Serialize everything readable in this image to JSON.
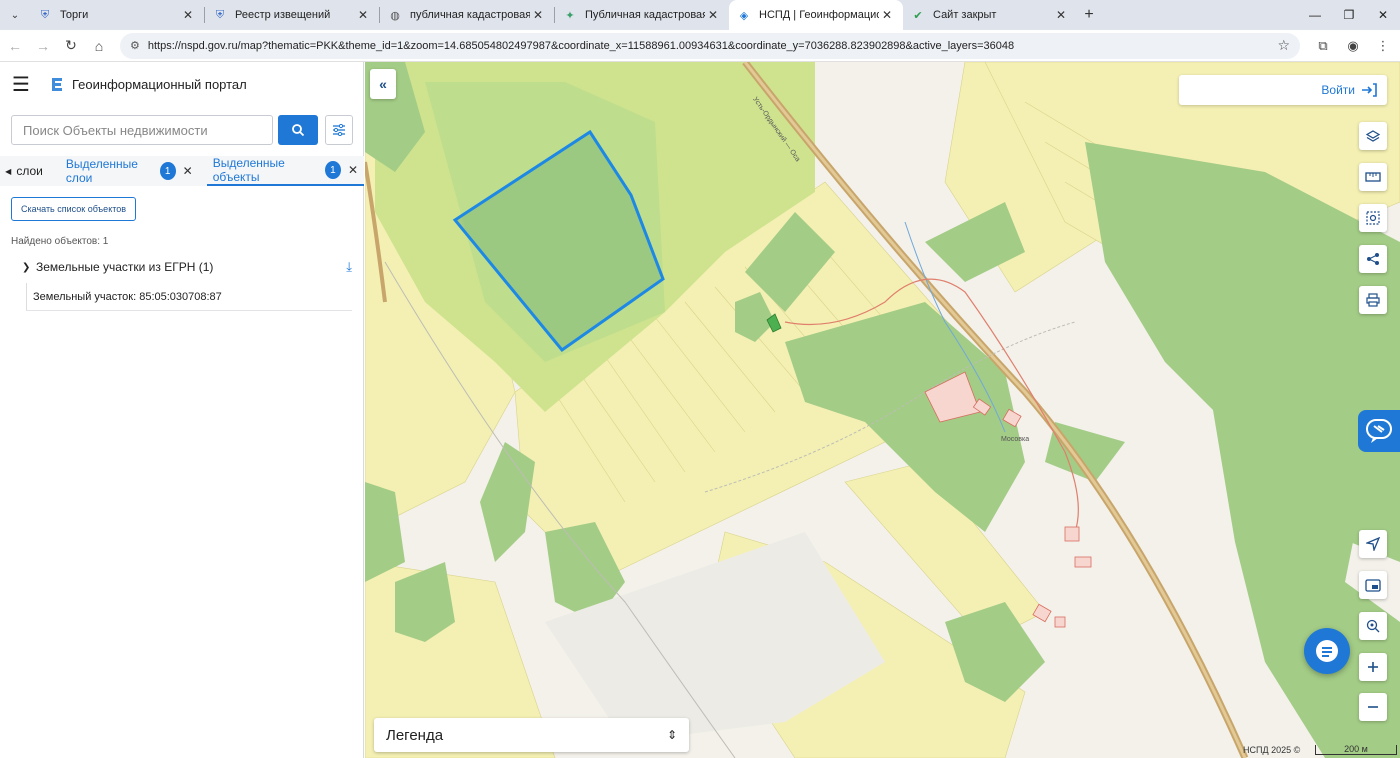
{
  "browser": {
    "tabs": [
      {
        "label": "Торги",
        "icon": "shield-icon"
      },
      {
        "label": "Реестр извещений",
        "icon": "shield-icon"
      },
      {
        "label": "публичная кадастровая карта",
        "icon": "globe-icon"
      },
      {
        "label": "Публичная кадастровая карта",
        "icon": "map-icon"
      },
      {
        "label": "НСПД | Геоинформационный",
        "icon": "nspd-icon",
        "active": true
      },
      {
        "label": "Сайт закрыт",
        "icon": "check-circle-icon"
      }
    ],
    "url": "https://nspd.gov.ru/map?thematic=PKK&theme_id=1&zoom=14.685054802497987&coordinate_x=11588961.00934631&coordinate_y=7036288.823902898&active_layers=36048"
  },
  "panel": {
    "title": "Геоинформационный портал",
    "search_placeholder": "Поиск Объекты недвижимости",
    "tabs": {
      "layers_label": "слои",
      "selected_layers_label": "Выделенные слои",
      "selected_layers_count": "1",
      "selected_objects_label": "Выделенные объекты",
      "selected_objects_count": "1"
    },
    "download_button": "Скачать список объектов",
    "found_text": "Найдено объектов: 1",
    "group_label": "Земельные участки из ЕГРН (1)",
    "item_label": "Земельный участок: 85:05:030708:87"
  },
  "map": {
    "login_label": "Войти",
    "legend_label": "Легенда",
    "copyright": "НСПД 2025 ©",
    "scale_label": "200 м",
    "road_label": "Усть-Ордынский — Оса",
    "village_label": "Мосовка",
    "colors": {
      "accent": "#1f78d6",
      "forest": "#a3cc86",
      "field": "#f4f0b3",
      "selected_parcel": "#1e88e5",
      "road": "#c8a66b"
    }
  }
}
